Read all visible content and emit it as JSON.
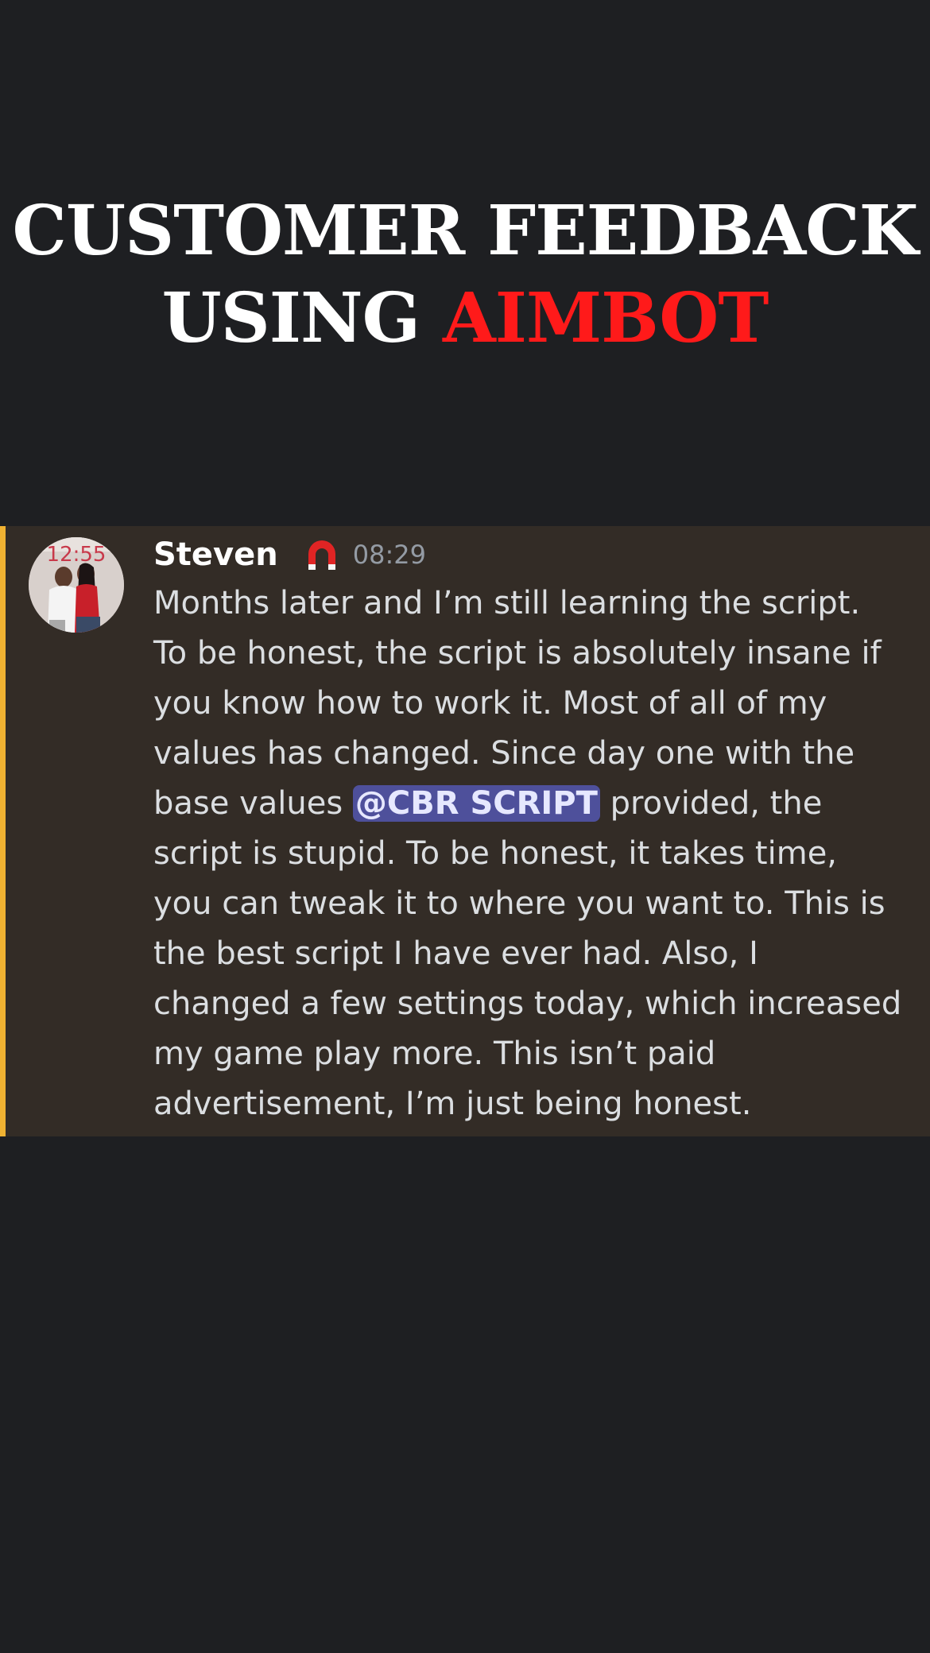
{
  "headline": {
    "line1": "CUSTOMER FEEDBACK",
    "line2_prefix": "USING",
    "line2_accent": "AIMBOT",
    "accent_color": "#ff1a1a"
  },
  "message": {
    "author": "Steven",
    "avatar_clock": "12:55",
    "role_icon": "red-white-badge-icon",
    "timestamp": "08:29",
    "highlight_color": "#f0b232",
    "lines": [
      "Months later and I’m still learning the script.",
      "To be honest, the script is absolutely insane if",
      "you know how to work it. Most of all of my",
      "values has changed. Since day one with the",
      "script is stupid. To be honest, it takes time,",
      "you can tweak it to where you want to. This is",
      "the best script I have ever had. Also, I",
      "changed a few settings today, which increased",
      "my game play more. This isn’t paid",
      "advertisement, I’m just being honest."
    ],
    "mention_line": {
      "before": "base values ",
      "mention": "@CBR SCRIPT",
      "after": " provided, the"
    }
  }
}
